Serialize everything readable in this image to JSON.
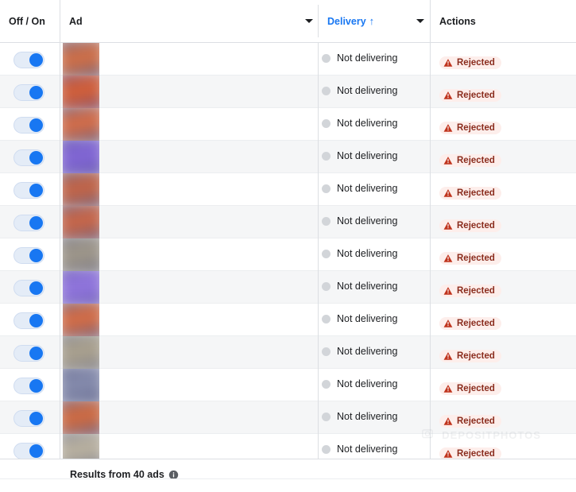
{
  "table": {
    "columns": [
      {
        "key": "off_on",
        "label": "Off / On",
        "sortable": false,
        "has_menu": false,
        "active_sort": false
      },
      {
        "key": "ad",
        "label": "Ad",
        "sortable": true,
        "has_menu": true,
        "active_sort": false
      },
      {
        "key": "delivery",
        "label": "Delivery",
        "sortable": true,
        "has_menu": true,
        "active_sort": true,
        "sort_arrow": "↑"
      },
      {
        "key": "actions",
        "label": "Actions",
        "sortable": false,
        "has_menu": false,
        "active_sort": false
      }
    ],
    "rows": [
      {
        "toggle_on": true,
        "thumb_color_a": "#e8733a",
        "thumb_color_b": "#5a5d86",
        "delivery": "Not delivering",
        "action": "Rejected"
      },
      {
        "toggle_on": true,
        "thumb_color_a": "#e8642c",
        "thumb_color_b": "#6b4a78",
        "delivery": "Not delivering",
        "action": "Rejected"
      },
      {
        "toggle_on": true,
        "thumb_color_a": "#f0713a",
        "thumb_color_b": "#4f5a8c",
        "delivery": "Not delivering",
        "action": "Rejected"
      },
      {
        "toggle_on": true,
        "thumb_color_a": "#8a6ce0",
        "thumb_color_b": "#5b4fa0",
        "delivery": "Not delivering",
        "action": "Rejected"
      },
      {
        "toggle_on": true,
        "thumb_color_a": "#d8663a",
        "thumb_color_b": "#5d5f88",
        "delivery": "Not delivering",
        "action": "Rejected"
      },
      {
        "toggle_on": true,
        "thumb_color_a": "#e0693c",
        "thumb_color_b": "#585a84",
        "delivery": "Not delivering",
        "action": "Rejected"
      },
      {
        "toggle_on": true,
        "thumb_color_a": "#a9a08c",
        "thumb_color_b": "#6a6a80",
        "delivery": "Not delivering",
        "action": "Rejected"
      },
      {
        "toggle_on": true,
        "thumb_color_a": "#9a7ce8",
        "thumb_color_b": "#6356a8",
        "delivery": "Not delivering",
        "action": "Rejected"
      },
      {
        "toggle_on": true,
        "thumb_color_a": "#ef7138",
        "thumb_color_b": "#555a88",
        "delivery": "Not delivering",
        "action": "Rejected"
      },
      {
        "toggle_on": true,
        "thumb_color_a": "#b6ab90",
        "thumb_color_b": "#707286",
        "delivery": "Not delivering",
        "action": "Rejected"
      },
      {
        "toggle_on": true,
        "thumb_color_a": "#8e94b4",
        "thumb_color_b": "#5a5f86",
        "delivery": "Not delivering",
        "action": "Rejected"
      },
      {
        "toggle_on": true,
        "thumb_color_a": "#e96f33",
        "thumb_color_b": "#565b8a",
        "delivery": "Not delivering",
        "action": "Rejected"
      },
      {
        "toggle_on": true,
        "thumb_color_a": "#c9bfa6",
        "thumb_color_b": "#6d6f84",
        "delivery": "Not delivering",
        "action": "Rejected"
      }
    ]
  },
  "footer": {
    "results_text": "Results from 40 ads",
    "info_icon": "info-icon"
  },
  "watermark": {
    "text": "DEPOSITPHOTOS"
  },
  "colors": {
    "accent_blue": "#1877f2",
    "rejected_text": "#8a2c1d",
    "rejected_bg": "#fdeeeb",
    "warning_red": "#c0341d",
    "row_alt_bg": "#f5f6f7",
    "border": "#dcdfe3",
    "status_dot": "#d2d5d9"
  }
}
